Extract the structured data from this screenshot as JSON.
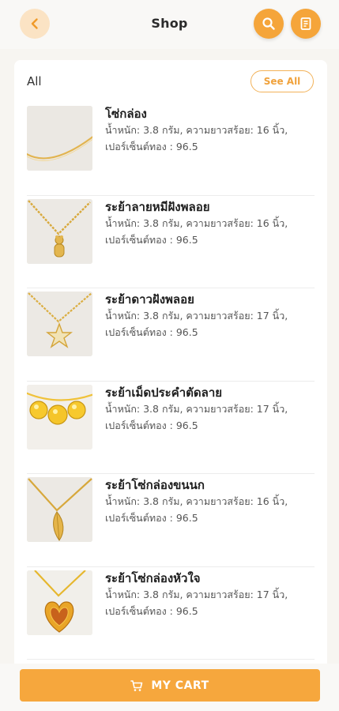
{
  "header": {
    "title": "Shop",
    "back_icon": "chevron-left-icon",
    "search_icon": "search-icon",
    "receipt_icon": "receipt-icon"
  },
  "colors": {
    "accent": "#f6a73d",
    "accent_light": "#fbe3c4",
    "background": "#f7f5f1"
  },
  "list": {
    "heading": "All",
    "see_all_label": "See All",
    "items": [
      {
        "name": "โซ่กล่อง",
        "spec_line1": "น้ำหนัก: 3.8 กรัม, ความยาวสร้อย: 16 นิ้ว,",
        "spec_line2": "เปอร์เซ็นต์ทอง : 96.5",
        "image": "chain-necklace"
      },
      {
        "name": "ระย้าลายหมีฝังพลอย",
        "spec_line1": "น้ำหนัก: 3.8 กรัม, ความยาวสร้อย: 16 นิ้ว,",
        "spec_line2": "เปอร์เซ็นต์ทอง : 96.5",
        "image": "bear-pendant-necklace"
      },
      {
        "name": "ระย้าดาวฝังพลอย",
        "spec_line1": "น้ำหนัก: 3.8 กรัม, ความยาวสร้อย: 17 นิ้ว,",
        "spec_line2": "เปอร์เซ็นต์ทอง : 96.5",
        "image": "star-pendant-necklace"
      },
      {
        "name": "ระย้าเม็ดประคำตัดลาย",
        "spec_line1": "น้ำหนัก: 3.8 กรัม, ความยาวสร้อย: 17 นิ้ว,",
        "spec_line2": "เปอร์เซ็นต์ทอง : 96.5",
        "image": "bead-necklace"
      },
      {
        "name": "ระย้าโซ่กล่องขนนก",
        "spec_line1": "น้ำหนัก: 3.8 กรัม, ความยาวสร้อย: 16 นิ้ว,",
        "spec_line2": "เปอร์เซ็นต์ทอง : 96.5",
        "image": "feather-pendant-necklace"
      },
      {
        "name": "ระย้าโซ่กล่องหัวใจ",
        "spec_line1": "น้ำหนัก: 3.8 กรัม, ความยาวสร้อย: 17 นิ้ว,",
        "spec_line2": "เปอร์เซ็นต์ทอง : 96.5",
        "image": "heart-pendant-necklace"
      }
    ]
  },
  "cart": {
    "label": "MY CART",
    "icon": "cart-icon"
  }
}
